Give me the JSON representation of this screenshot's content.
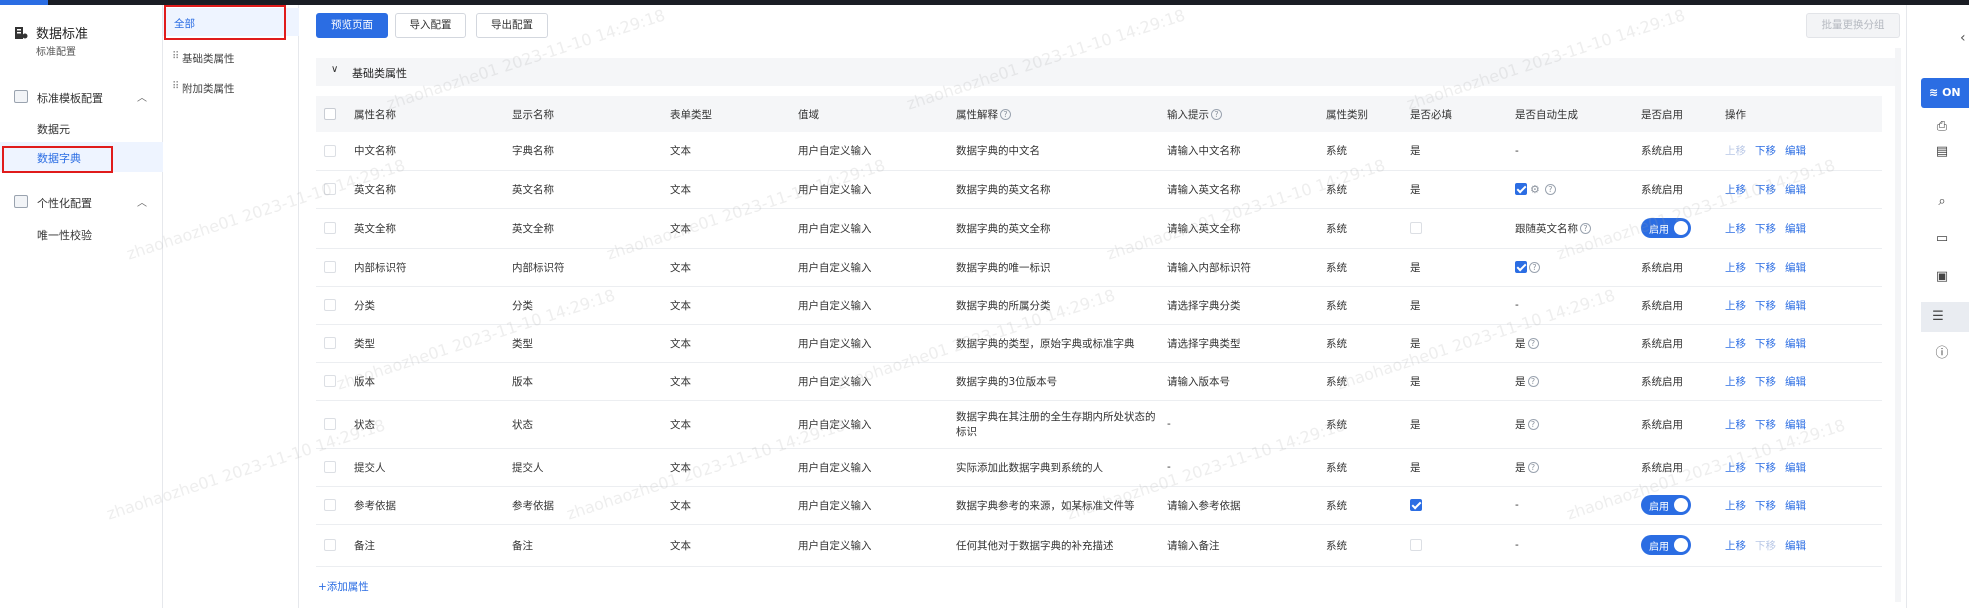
{
  "app": {
    "title": "数据标准",
    "subtitle": "标准配置"
  },
  "sidebar": {
    "groups": [
      {
        "label": "标准模板配置",
        "items": [
          {
            "label": "数据元"
          },
          {
            "label": "数据字典"
          }
        ]
      },
      {
        "label": "个性化配置",
        "items": [
          {
            "label": "唯一性校验"
          }
        ]
      }
    ]
  },
  "categories": [
    {
      "label": "全部"
    },
    {
      "label": "基础类属性"
    },
    {
      "label": "附加类属性"
    }
  ],
  "toolbar": {
    "preview_label": "预览页面",
    "import_label": "导入配置",
    "export_label": "导出配置",
    "batch_label": "批量更换分组"
  },
  "section": {
    "title": "基础类属性"
  },
  "table": {
    "columns": [
      "属性名称",
      "显示名称",
      "表单类型",
      "值域",
      "属性解释",
      "输入提示",
      "属性类别",
      "是否必填",
      "是否自动生成",
      "是否启用",
      "操作"
    ],
    "rows": [
      {
        "name": "中文名称",
        "display": "字典名称",
        "form": "文本",
        "domain": "用户自定义输入",
        "desc": "数据字典的中文名",
        "hint": "请输入中文名称",
        "kind": "系统",
        "required": "是",
        "auto": "-",
        "enabled": "系统启用"
      },
      {
        "name": "英文名称",
        "display": "英文名称",
        "form": "文本",
        "domain": "用户自定义输入",
        "desc": "数据字典的英文名称",
        "hint": "请输入英文名称",
        "kind": "系统",
        "required": "是",
        "auto": "",
        "enabled": "系统启用"
      },
      {
        "name": "英文全称",
        "display": "英文全称",
        "form": "文本",
        "domain": "用户自定义输入",
        "desc": "数据字典的英文全称",
        "hint": "请输入英文全称",
        "kind": "系统",
        "required": "",
        "auto": "跟随英文名称",
        "enabled": "启用"
      },
      {
        "name": "内部标识符",
        "display": "内部标识符",
        "form": "文本",
        "domain": "用户自定义输入",
        "desc": "数据字典的唯一标识",
        "hint": "请输入内部标识符",
        "kind": "系统",
        "required": "是",
        "auto": "",
        "enabled": "系统启用"
      },
      {
        "name": "分类",
        "display": "分类",
        "form": "文本",
        "domain": "用户自定义输入",
        "desc": "数据字典的所属分类",
        "hint": "请选择字典分类",
        "kind": "系统",
        "required": "是",
        "auto": "-",
        "enabled": "系统启用"
      },
      {
        "name": "类型",
        "display": "类型",
        "form": "文本",
        "domain": "用户自定义输入",
        "desc": "数据字典的类型，原始字典或标准字典",
        "hint": "请选择字典类型",
        "kind": "系统",
        "required": "是",
        "auto": "是",
        "enabled": "系统启用"
      },
      {
        "name": "版本",
        "display": "版本",
        "form": "文本",
        "domain": "用户自定义输入",
        "desc": "数据字典的3位版本号",
        "hint": "请输入版本号",
        "kind": "系统",
        "required": "是",
        "auto": "是",
        "enabled": "系统启用"
      },
      {
        "name": "状态",
        "display": "状态",
        "form": "文本",
        "domain": "用户自定义输入",
        "desc": "数据字典在其注册的全生存期内所处状态的标识",
        "hint": "-",
        "kind": "系统",
        "required": "是",
        "auto": "是",
        "enabled": "系统启用"
      },
      {
        "name": "提交人",
        "display": "提交人",
        "form": "文本",
        "domain": "用户自定义输入",
        "desc": "实际添加此数据字典到系统的人",
        "hint": "-",
        "kind": "系统",
        "required": "是",
        "auto": "是",
        "enabled": "系统启用"
      },
      {
        "name": "参考依据",
        "display": "参考依据",
        "form": "文本",
        "domain": "用户自定义输入",
        "desc": "数据字典参考的来源，如某标准文件等",
        "hint": "请输入参考依据",
        "kind": "系统",
        "required": "",
        "auto": "-",
        "enabled": "启用"
      },
      {
        "name": "备注",
        "display": "备注",
        "form": "文本",
        "domain": "用户自定义输入",
        "desc": "任何其他对于数据字典的补充描述",
        "hint": "请输入备注",
        "kind": "系统",
        "required": "",
        "auto": "-",
        "enabled": "启用"
      }
    ],
    "ops": {
      "up": "上移",
      "down": "下移",
      "edit": "编辑"
    }
  },
  "add_link": "+添加属性",
  "rail": {
    "on_label": "ON"
  },
  "watermark": "zhaohaozhe01 2023-11-10 14:29:18"
}
